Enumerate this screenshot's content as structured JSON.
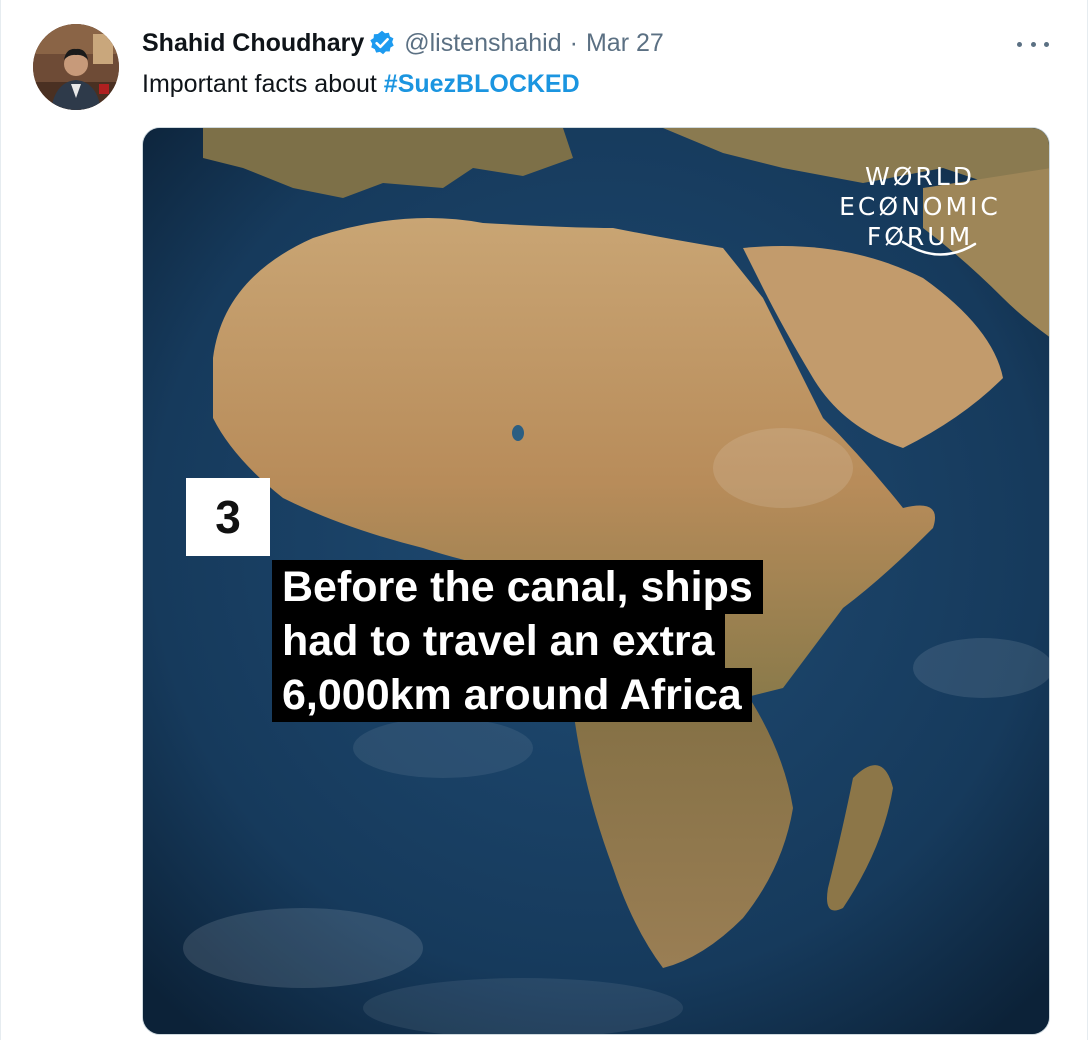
{
  "tweet": {
    "author_name": "Shahid Choudhary",
    "handle": "@listenshahid",
    "separator": "·",
    "time": "Mar 27",
    "text_prefix": "Important facts about ",
    "hashtag": "#SuezBLOCKED"
  },
  "media": {
    "logo_lines": [
      "WØRLD",
      "ECØNOMIC",
      "FØRUM"
    ],
    "fact_number": "3",
    "caption_lines": [
      "Before the canal, ships",
      "had to travel an extra",
      "6,000km around Africa"
    ]
  },
  "icons": {
    "verified": "verified-badge-icon",
    "more": "more-options-icon"
  },
  "colors": {
    "link": "#1b95e0",
    "verified": "#1d9bf0",
    "muted": "#5b7083",
    "text": "#0f1419",
    "ocean": "#15304f",
    "land": "#b48a5a"
  }
}
